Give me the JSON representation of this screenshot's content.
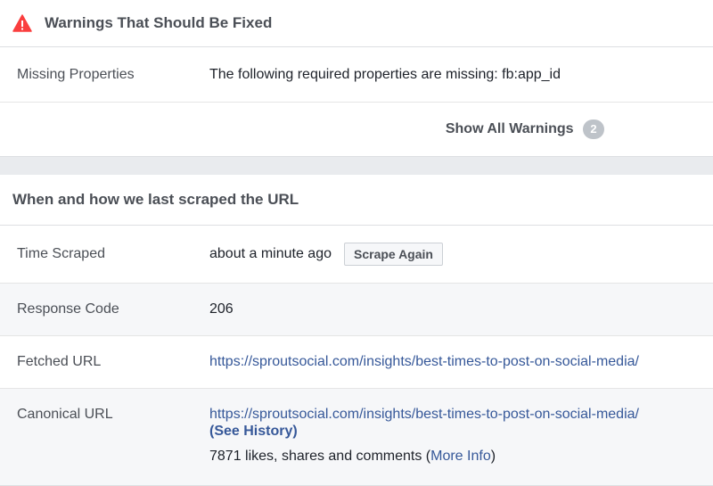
{
  "warnings": {
    "title": "Warnings That Should Be Fixed",
    "icon": "warning-triangle-icon",
    "icon_color": "#fa3e3e",
    "rows": [
      {
        "label": "Missing Properties",
        "value": "The following required properties are missing: fb:app_id"
      }
    ],
    "show_all_label": "Show All Warnings",
    "count": "2"
  },
  "scrape": {
    "title": "When and how we last scraped the URL",
    "time_scraped": {
      "label": "Time Scraped",
      "value": "about a minute ago",
      "button": "Scrape Again"
    },
    "response_code": {
      "label": "Response Code",
      "value": "206"
    },
    "fetched_url": {
      "label": "Fetched URL",
      "value": "https://sproutsocial.com/insights/best-times-to-post-on-social-media/"
    },
    "canonical_url": {
      "label": "Canonical URL",
      "value": "https://sproutsocial.com/insights/best-times-to-post-on-social-media/",
      "history": "(See History)",
      "engagement_text": "7871 likes, shares and comments (",
      "more_info": "More Info",
      "close_paren": ")"
    }
  },
  "colors": {
    "link": "#365899",
    "background": "#e9ebee"
  }
}
